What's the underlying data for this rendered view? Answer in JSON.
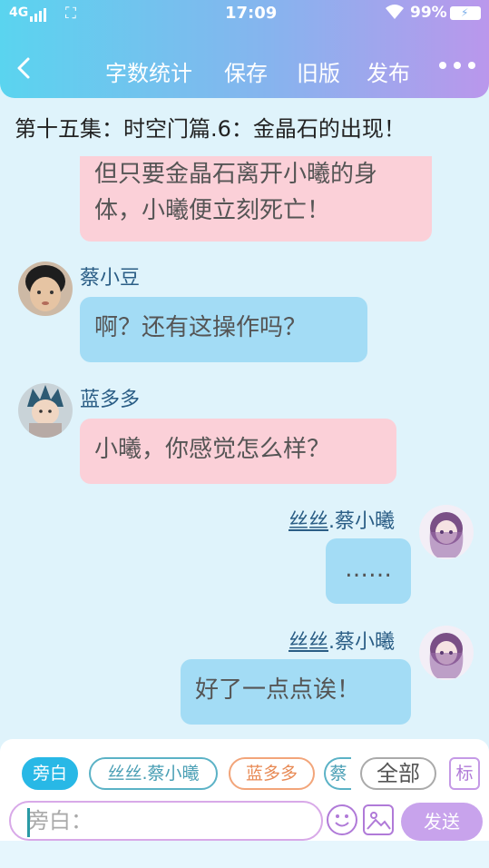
{
  "status_bar": {
    "network": "4G",
    "time": "17:09",
    "battery": "99%"
  },
  "toolbar": {
    "word_count": "字数统计",
    "save": "保存",
    "old_version": "旧版",
    "publish": "发布"
  },
  "episode": {
    "title": "第十五集：时空门篇.6：金晶石的出现！"
  },
  "messages": [
    {
      "text": "但只要金晶石离开小曦的身体，小曦便立刻死亡！"
    },
    {
      "sender": "蔡小豆",
      "text": "啊？还有这操作吗？"
    },
    {
      "sender": "蓝多多",
      "text": "小曦，你感觉怎么样？"
    },
    {
      "sender_prefix": "丝丝",
      "sender_suffix": ".蔡小曦",
      "text": "……"
    },
    {
      "sender_prefix": "丝丝",
      "sender_suffix": ".蔡小曦",
      "text": "好了一点点诶！"
    }
  ],
  "roles": {
    "narration": "旁白",
    "sisi": "丝丝.蔡小曦",
    "landuoduo": "蓝多多",
    "partial": "蔡",
    "all": "全部",
    "mark": "标"
  },
  "composer": {
    "placeholder": "旁白：",
    "send_label": "发送"
  },
  "colors": {
    "header_start": "#5ad4ef",
    "header_end": "#ba97ec",
    "bubble_pink": "#fbd0d8",
    "bubble_blue": "#a3dcf5",
    "send_button": "#c8a3ec"
  }
}
